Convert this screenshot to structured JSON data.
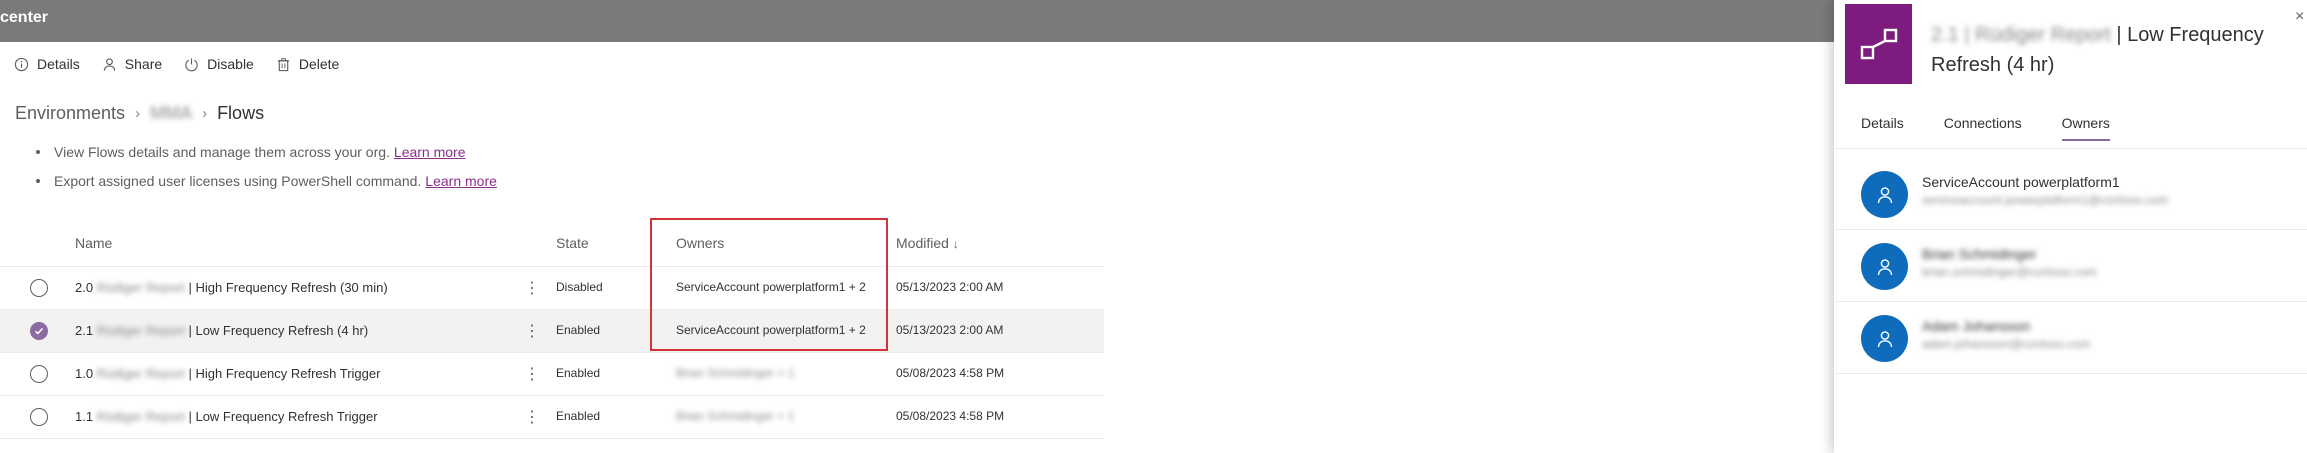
{
  "header": {
    "title": "center"
  },
  "commands": [
    {
      "label": "Details",
      "icon": "info-icon"
    },
    {
      "label": "Share",
      "icon": "person-icon"
    },
    {
      "label": "Disable",
      "icon": "power-icon"
    },
    {
      "label": "Delete",
      "icon": "trash-icon"
    }
  ],
  "breadcrumb": {
    "root": "Environments",
    "env": "MMA",
    "current": "Flows"
  },
  "bullets": [
    {
      "text": "View Flows details and manage them across your org.",
      "link": "Learn more"
    },
    {
      "text": "Export assigned user licenses using PowerShell command.",
      "link": "Learn more"
    }
  ],
  "table": {
    "columns": {
      "name": "Name",
      "state": "State",
      "owners": "Owners",
      "modified": "Modified",
      "sort_arrow": "↓"
    },
    "rows": [
      {
        "prefix": "2.0",
        "blurred": "Rüdiger Report",
        "suffix": "| High Frequency Refresh (30 min)",
        "state": "Disabled",
        "owners": "ServiceAccount powerplatform1 + 2",
        "modified": "05/13/2023 2:00 AM"
      },
      {
        "prefix": "2.1",
        "blurred": "Rüdiger Report",
        "suffix": "| Low Frequency Refresh (4 hr)",
        "state": "Enabled",
        "owners": "ServiceAccount powerplatform1 + 2",
        "modified": "05/13/2023 2:00 AM"
      },
      {
        "prefix": "1.0",
        "blurred": "Rüdiger Report",
        "suffix": "| High Frequency Refresh Trigger",
        "state": "Enabled",
        "owners": "Brian Schmidinger + 1",
        "modified": "05/08/2023 4:58 PM"
      },
      {
        "prefix": "1.1",
        "blurred": "Rüdiger Report",
        "suffix": "| Low Frequency Refresh Trigger",
        "state": "Enabled",
        "owners": "Brian Schmidinger + 1",
        "modified": "05/08/2023 4:58 PM"
      }
    ]
  },
  "panel": {
    "title_blurred": "2.1 | Rüdiger Report",
    "title_line1": "| Low Frequency",
    "title_line2": "Refresh (4 hr)",
    "close": "×",
    "tabs": [
      "Details",
      "Connections",
      "Owners"
    ],
    "active_tab": "Owners",
    "owners": [
      {
        "name": "ServiceAccount powerplatform1",
        "email": "serviceaccount.powerplatform1@contoso.com"
      },
      {
        "name": "Brian Schmidinger",
        "email": "brian.schmidinger@contoso.com"
      },
      {
        "name": "Adam Johansson",
        "email": "adam.johansson@contoso.com"
      }
    ]
  },
  "colors": {
    "accent": "#8c6aa2",
    "flow_icon": "#7d1b7e",
    "avatar": "#0f6cbd",
    "highlight": "#d13438",
    "header": "#7a7a7a"
  }
}
